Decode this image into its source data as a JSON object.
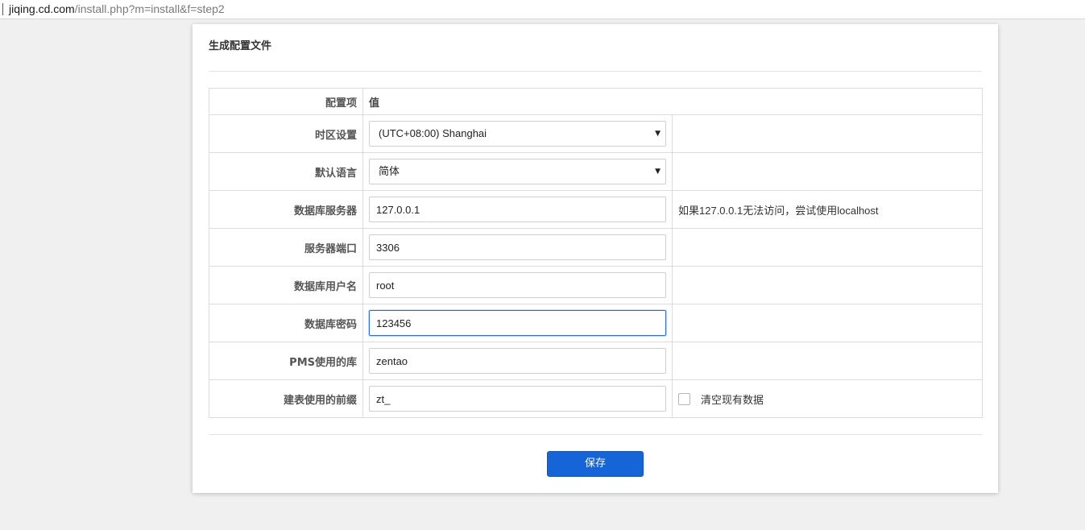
{
  "browser": {
    "url_host": "jiqing.cd.com",
    "url_path": "/install.php?m=install&f=step2"
  },
  "card": {
    "title": "生成配置文件"
  },
  "table": {
    "header": {
      "item": "配置项",
      "value": "值"
    },
    "rows": {
      "timezone": {
        "label": "时区设置",
        "value": "(UTC+08:00) Shanghai"
      },
      "language": {
        "label": "默认语言",
        "value": "简体"
      },
      "db_host": {
        "label": "数据库服务器",
        "value": "127.0.0.1",
        "hint": "如果127.0.0.1无法访问，尝试使用localhost"
      },
      "db_port": {
        "label": "服务器端口",
        "value": "3306"
      },
      "db_user": {
        "label": "数据库用户名",
        "value": "root"
      },
      "db_password": {
        "label": "数据库密码",
        "value": "123456"
      },
      "db_name": {
        "label": "PMS使用的库",
        "value": "zentao"
      },
      "db_prefix": {
        "label": "建表使用的前缀",
        "value": "zt_",
        "checkbox_label": "清空现有数据",
        "checkbox_checked": false
      }
    }
  },
  "actions": {
    "save_label": "保存"
  },
  "colors": {
    "primary": "#1565d8",
    "focus_border": "#2d6fd6",
    "page_background": "#f0f0f0"
  }
}
